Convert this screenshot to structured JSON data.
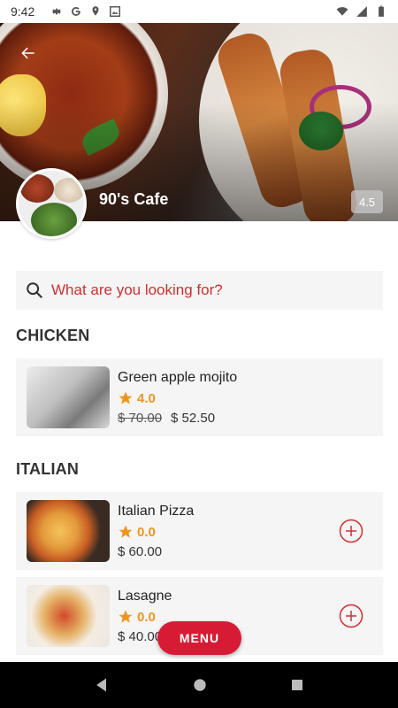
{
  "status_bar": {
    "time": "9:42",
    "left_icons": [
      "gear-icon",
      "google-icon",
      "location-icon",
      "image-icon"
    ],
    "right_icons": [
      "wifi-icon",
      "signal-icon",
      "battery-icon"
    ]
  },
  "header": {
    "cafe_name": "90's Cafe",
    "rating": "4.5"
  },
  "search": {
    "placeholder": "What are you looking for?"
  },
  "sections": [
    {
      "title": "CHICKEN",
      "items": [
        {
          "name": "Green apple mojito",
          "rating": "4.0",
          "old_price": "$ 70.00",
          "price": "$ 52.50",
          "has_add": false
        }
      ]
    },
    {
      "title": "ITALIAN",
      "items": [
        {
          "name": "Italian Pizza",
          "rating": "0.0",
          "old_price": "",
          "price": "$ 60.00",
          "has_add": true
        },
        {
          "name": "Lasagne",
          "rating": "0.0",
          "old_price": "",
          "price": "$ 40.00",
          "has_add": true
        }
      ]
    }
  ],
  "fab": {
    "label": "MENU"
  },
  "colors": {
    "accent": "#d32f2f",
    "star": "#f0951a",
    "fab": "#d81b34"
  }
}
